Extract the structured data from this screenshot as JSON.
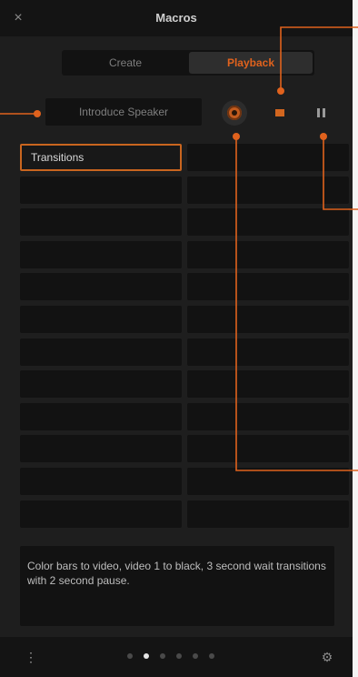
{
  "window": {
    "title": "Macros",
    "close_icon": "close-icon"
  },
  "tabs": [
    {
      "label": "Create",
      "active": false
    },
    {
      "label": "Playback",
      "active": true
    }
  ],
  "macro_name": "Introduce Speaker",
  "toolbar": {
    "record_icon": "record-icon",
    "stop_icon": "stop-icon",
    "pause_icon": "pause-icon"
  },
  "macro_slots": [
    {
      "left": "Transitions",
      "right": ""
    },
    {
      "left": "",
      "right": ""
    },
    {
      "left": "",
      "right": ""
    },
    {
      "left": "",
      "right": ""
    },
    {
      "left": "",
      "right": ""
    },
    {
      "left": "",
      "right": ""
    },
    {
      "left": "",
      "right": ""
    },
    {
      "left": "",
      "right": ""
    },
    {
      "left": "",
      "right": ""
    },
    {
      "left": "",
      "right": ""
    },
    {
      "left": "",
      "right": ""
    },
    {
      "left": "",
      "right": ""
    }
  ],
  "description": "Color bars to video, video 1 to black, 3 second wait transitions with 2 second pause.",
  "footer": {
    "left_icon": "tools-icon",
    "right_icon": "settings-icon",
    "page_count": 6,
    "active_page": 1
  },
  "colors": {
    "accent": "#e0621d",
    "callout": "#e0621d",
    "panel": "#1e1e1e",
    "field": "#121212"
  }
}
